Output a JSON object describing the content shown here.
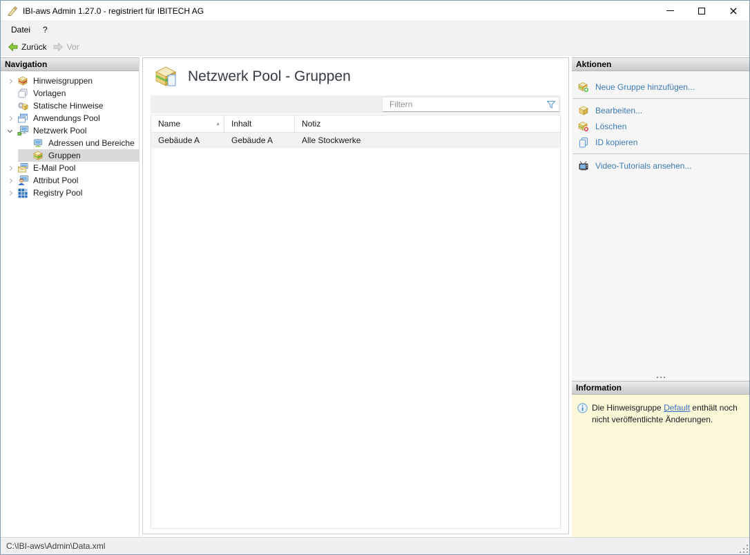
{
  "window": {
    "title": "IBI-aws Admin 1.27.0 - registriert für IBITECH AG"
  },
  "menu": {
    "items": [
      "Datei",
      "?"
    ]
  },
  "toolbar": {
    "back": "Zurück",
    "forward": "Vor"
  },
  "navigation": {
    "header": "Navigation",
    "items": [
      {
        "label": "Hinweisgruppen",
        "expander": "collapsed",
        "level": 0,
        "selected": false,
        "icon": "notice-groups-icon"
      },
      {
        "label": "Vorlagen",
        "expander": "none",
        "level": 0,
        "selected": false,
        "icon": "templates-icon"
      },
      {
        "label": "Statische Hinweise",
        "expander": "none",
        "level": 0,
        "selected": false,
        "icon": "static-notices-icon"
      },
      {
        "label": "Anwendungs Pool",
        "expander": "collapsed",
        "level": 0,
        "selected": false,
        "icon": "application-pool-icon"
      },
      {
        "label": "Netzwerk Pool",
        "expander": "expanded",
        "level": 0,
        "selected": false,
        "icon": "network-pool-icon"
      },
      {
        "label": "Adressen und Bereiche",
        "expander": "none",
        "level": 1,
        "selected": false,
        "icon": "addresses-icon"
      },
      {
        "label": "Gruppen",
        "expander": "none",
        "level": 1,
        "selected": true,
        "icon": "group-package-icon"
      },
      {
        "label": "E-Mail Pool",
        "expander": "collapsed",
        "level": 0,
        "selected": false,
        "icon": "email-pool-icon"
      },
      {
        "label": "Attribut Pool",
        "expander": "collapsed",
        "level": 0,
        "selected": false,
        "icon": "attribute-pool-icon"
      },
      {
        "label": "Registry Pool",
        "expander": "collapsed",
        "level": 0,
        "selected": false,
        "icon": "registry-pool-icon"
      }
    ]
  },
  "main": {
    "title": "Netzwerk Pool - Gruppen",
    "filter_placeholder": "Filtern",
    "table": {
      "columns": [
        "Name",
        "Inhalt",
        "Notiz"
      ],
      "sort_column": "Name",
      "sort_direction": "asc",
      "rows": [
        [
          "Gebäude A",
          "Gebäude A",
          "Alle Stockwerke"
        ]
      ]
    }
  },
  "actions": {
    "header": "Aktionen",
    "items": [
      {
        "label": "Neue Gruppe hinzufügen...",
        "icon": "package-add-icon"
      },
      {
        "label": "Bearbeiten...",
        "icon": "package-edit-icon"
      },
      {
        "label": "Löschen",
        "icon": "package-delete-icon"
      },
      {
        "label": "ID kopieren",
        "icon": "copy-icon"
      },
      {
        "label": "Video-Tutorials ansehen...",
        "icon": "tv-icon"
      }
    ]
  },
  "information": {
    "header": "Information",
    "text_before": "Die Hinweisgruppe ",
    "link": "Default",
    "text_after": " enthält noch nicht veröffentlichte Änderungen."
  },
  "statusbar": {
    "path": "C:\\IBI-aws\\Admin\\Data.xml"
  },
  "colors": {
    "link_blue": "#3e7ab6",
    "selection_gray": "#d9d9d9",
    "info_background": "#fcf9da",
    "panel_header_gradient": [
      "#ececec",
      "#cccccc"
    ],
    "back_arrow_green": "#8cc63e"
  }
}
